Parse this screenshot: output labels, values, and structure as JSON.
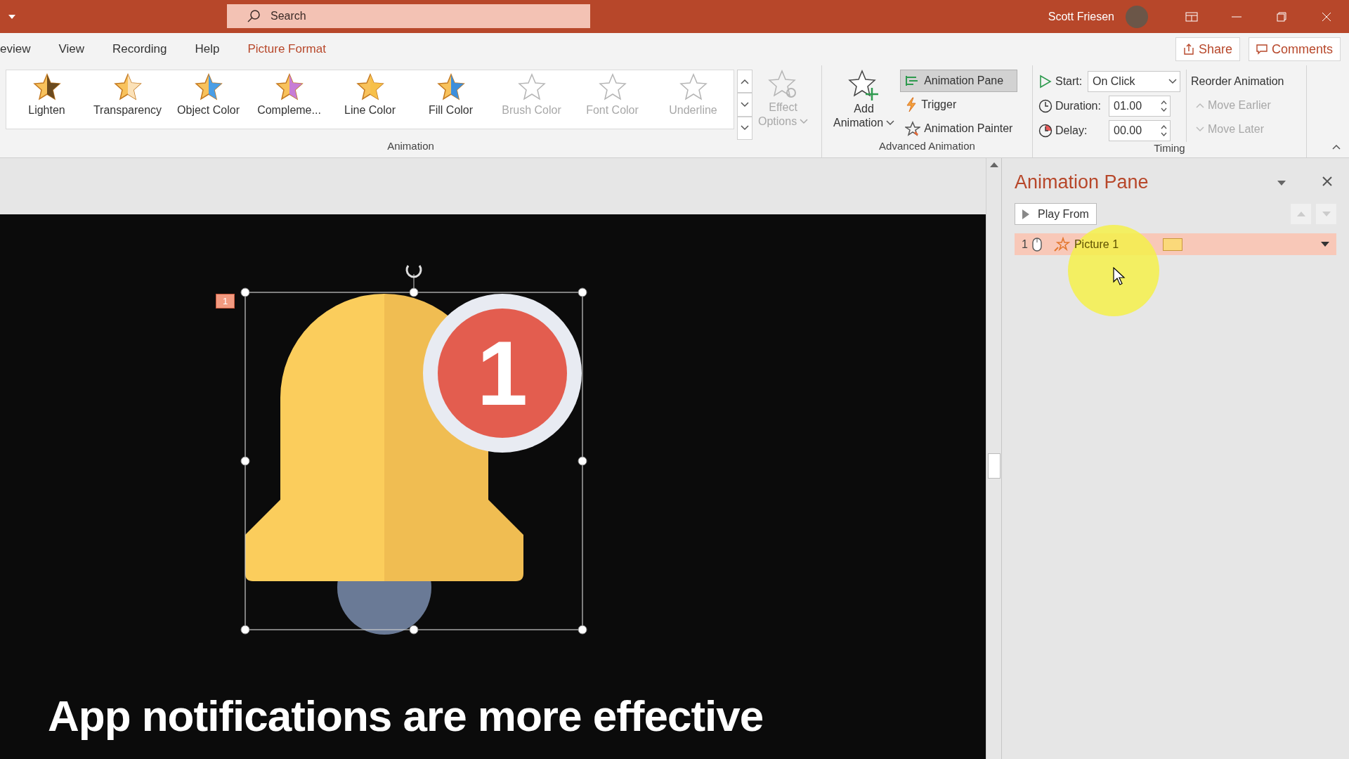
{
  "title_bar": {
    "search": {
      "placeholder": "Search"
    },
    "user": "Scott Friesen"
  },
  "tabs": [
    {
      "label": "eview",
      "kind": "normal"
    },
    {
      "label": "View",
      "kind": "normal"
    },
    {
      "label": "Recording",
      "kind": "normal"
    },
    {
      "label": "Help",
      "kind": "normal"
    },
    {
      "label": "Picture Format",
      "kind": "contextual"
    }
  ],
  "share_button": "Share",
  "comments_button": "Comments",
  "animation_group": {
    "label": "Animation",
    "effects": [
      {
        "label": "Lighten",
        "color": "#6b4a1e",
        "disabled": false
      },
      {
        "label": "Transparency",
        "color": "#fbe1b8",
        "disabled": false
      },
      {
        "label": "Object Color",
        "color": "#4a9ee6",
        "disabled": false
      },
      {
        "label": "Compleme...",
        "color": "#c77dd6",
        "disabled": false
      },
      {
        "label": "Line Color",
        "color": "#f7c04a",
        "disabled": false
      },
      {
        "label": "Fill Color",
        "color": "#3d8fdc",
        "disabled": false
      },
      {
        "label": "Brush Color",
        "color": "#b5b5b5",
        "disabled": true
      },
      {
        "label": "Font Color",
        "color": "#b5b5b5",
        "disabled": true
      },
      {
        "label": "Underline",
        "color": "#b5b5b5",
        "disabled": true
      }
    ],
    "effect_options": {
      "line1": "Effect",
      "line2": "Options",
      "disabled": true
    }
  },
  "advanced_group": {
    "label": "Advanced Animation",
    "add_animation": {
      "line1": "Add",
      "line2": "Animation"
    },
    "buttons": [
      {
        "label": "Animation Pane",
        "kind": "pane",
        "selected": true
      },
      {
        "label": "Trigger",
        "kind": "trigger",
        "selected": false
      },
      {
        "label": "Animation Painter",
        "kind": "painter",
        "selected": false
      }
    ]
  },
  "timing_group": {
    "label": "Timing",
    "start": {
      "label": "Start:",
      "value": "On Click"
    },
    "duration": {
      "label": "Duration:",
      "value": "01.00"
    },
    "delay": {
      "label": "Delay:",
      "value": "00.00"
    },
    "reorder": {
      "title": "Reorder Animation",
      "items": [
        {
          "label": "Move Earlier",
          "kind": "up",
          "disabled": true
        },
        {
          "label": "Move Later",
          "kind": "down",
          "disabled": true
        }
      ]
    }
  },
  "slide": {
    "animation_tag": "1",
    "badge_text": "1",
    "caption": "App notifications are more effective"
  },
  "animation_pane": {
    "title": "Animation Pane",
    "play_button": "Play From",
    "items": [
      {
        "number": "1",
        "name": "Picture 1",
        "selected": true
      }
    ]
  }
}
